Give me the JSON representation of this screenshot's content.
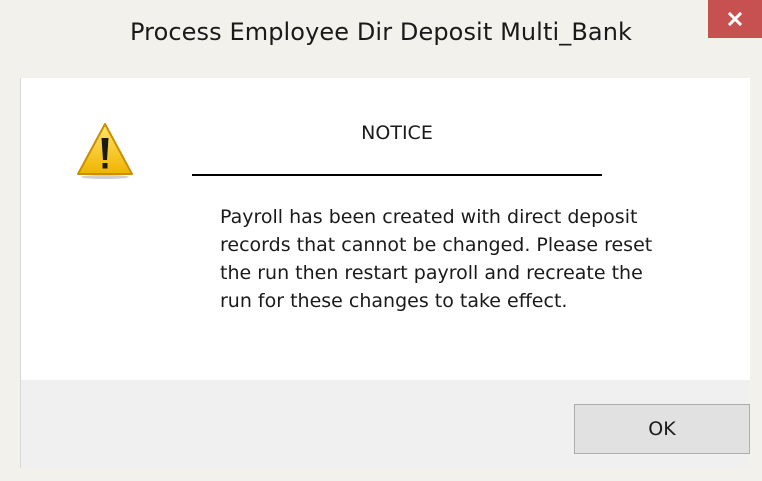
{
  "window": {
    "title": "Process Employee Dir Deposit Multi_Bank",
    "close_icon": "close-icon",
    "accent_close_color": "#c75050"
  },
  "dialog": {
    "icon": "warning-icon",
    "icon_color": "#f5c400",
    "heading": "NOTICE",
    "message": "Payroll has been created with direct deposit\nrecords that cannot be changed. Please reset\nthe run then restart payroll and recreate the\nrun for these changes to take effect."
  },
  "buttons": {
    "ok_label": "OK"
  }
}
